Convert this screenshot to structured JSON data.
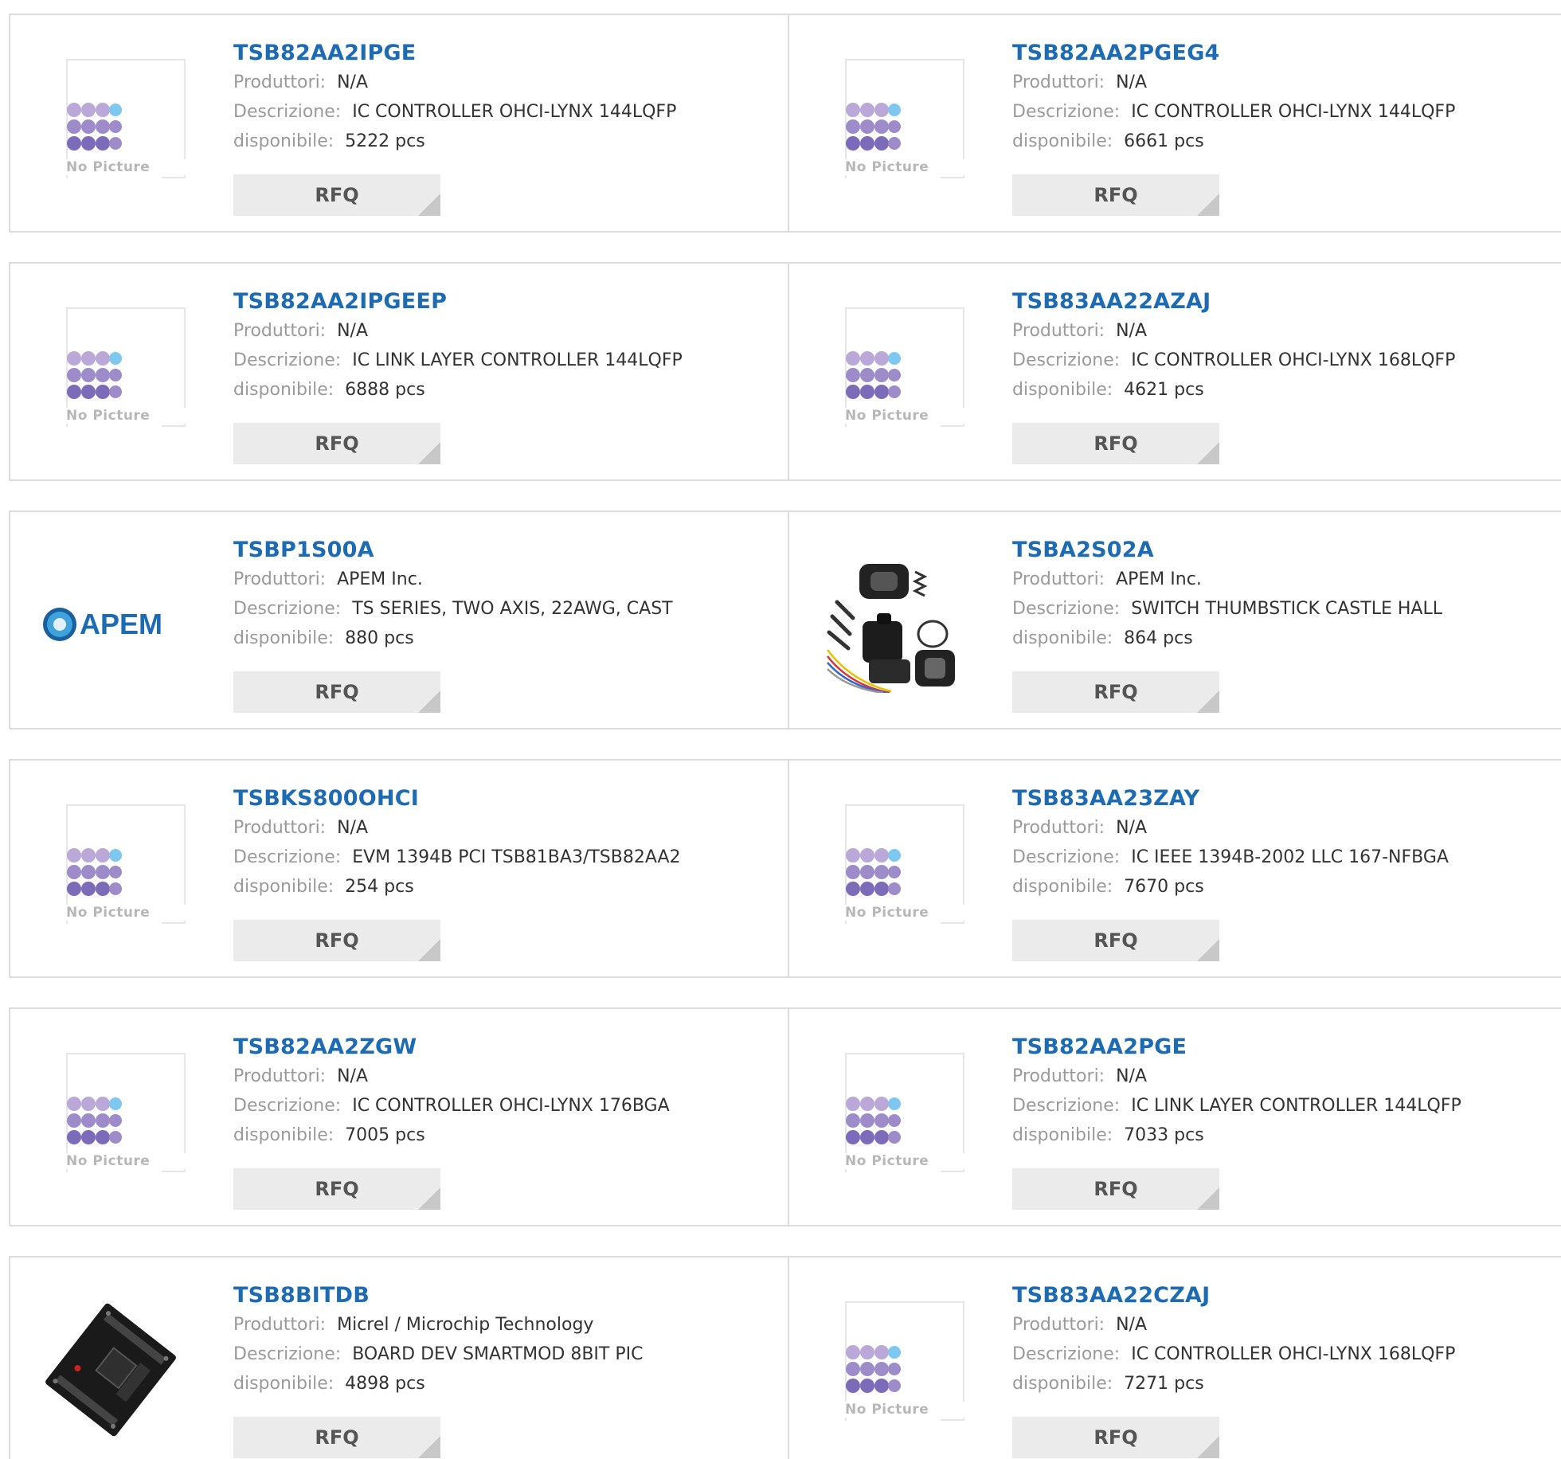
{
  "labels": {
    "manufacturer": "Produttori:",
    "description": "Descrizione:",
    "availability": "disponibile:",
    "rfq": "RFQ",
    "no_picture": "No Picture"
  },
  "colors": {
    "part_link": "#1d6bb3",
    "label_gray": "#9a9a9a",
    "border": "#dcdcdc",
    "rfq_bg": "#ebebeb"
  },
  "products": [
    {
      "part": "TSB82AA2IPGE",
      "manufacturer": "N/A",
      "description": "IC CONTROLLER OHCI-LYNX 144LQFP",
      "availability": "5222 pcs",
      "image": "no-picture"
    },
    {
      "part": "TSB82AA2PGEG4",
      "manufacturer": "N/A",
      "description": "IC CONTROLLER OHCI-LYNX 144LQFP",
      "availability": "6661 pcs",
      "image": "no-picture"
    },
    {
      "part": "TSB82AA2IPGEEP",
      "manufacturer": "N/A",
      "description": "IC LINK LAYER CONTROLLER 144LQFP",
      "availability": "6888 pcs",
      "image": "no-picture"
    },
    {
      "part": "TSB83AA22AZAJ",
      "manufacturer": "N/A",
      "description": "IC CONTROLLER OHCI-LYNX 168LQFP",
      "availability": "4621 pcs",
      "image": "no-picture"
    },
    {
      "part": "TSBP1S00A",
      "manufacturer": "APEM Inc.",
      "description": "TS SERIES, TWO AXIS, 22AWG, CAST",
      "availability": "880 pcs",
      "image": "apem-logo",
      "logo_text": "APEM"
    },
    {
      "part": "TSBA2S02A",
      "manufacturer": "APEM Inc.",
      "description": "SWITCH THUMBSTICK CASTLE HALL",
      "availability": "864 pcs",
      "image": "thumbstick-photo"
    },
    {
      "part": "TSBKS800OHCI",
      "manufacturer": "N/A",
      "description": "EVM 1394B PCI TSB81BA3/TSB82AA2",
      "availability": "254 pcs",
      "image": "no-picture"
    },
    {
      "part": "TSB83AA23ZAY",
      "manufacturer": "N/A",
      "description": "IC IEEE 1394B-2002 LLC 167-NFBGA",
      "availability": "7670 pcs",
      "image": "no-picture"
    },
    {
      "part": "TSB82AA2ZGW",
      "manufacturer": "N/A",
      "description": "IC CONTROLLER OHCI-LYNX 176BGA",
      "availability": "7005 pcs",
      "image": "no-picture"
    },
    {
      "part": "TSB82AA2PGE",
      "manufacturer": "N/A",
      "description": "IC LINK LAYER CONTROLLER 144LQFP",
      "availability": "7033 pcs",
      "image": "no-picture"
    },
    {
      "part": "TSB8BITDB",
      "manufacturer": "Micrel / Microchip Technology",
      "description": "BOARD DEV SMARTMOD 8BIT PIC",
      "availability": "4898 pcs",
      "image": "board-photo"
    },
    {
      "part": "TSB83AA22CZAJ",
      "manufacturer": "N/A",
      "description": "IC CONTROLLER OHCI-LYNX 168LQFP",
      "availability": "7271 pcs",
      "image": "no-picture"
    }
  ]
}
